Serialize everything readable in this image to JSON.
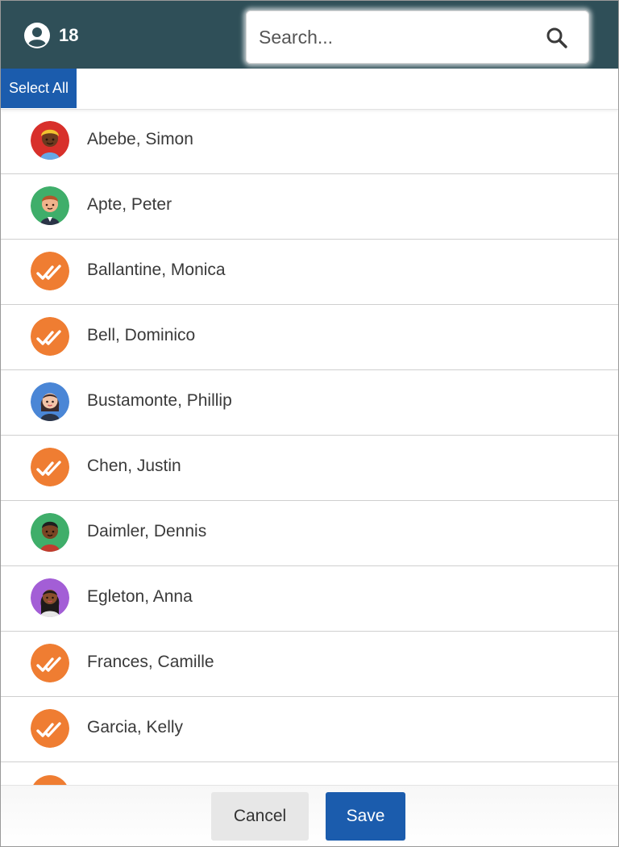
{
  "header": {
    "user_count": "18",
    "user_icon": "user-circle-icon",
    "search_placeholder": "Search...",
    "search_icon": "search-icon",
    "background_color": "#2f4f58"
  },
  "toolbar": {
    "select_all_label": "Select All",
    "accent_color": "#1b5cad"
  },
  "list": {
    "items": [
      {
        "name": "Abebe, Simon",
        "avatar": "avatar-person-red"
      },
      {
        "name": "Apte, Peter",
        "avatar": "avatar-person-green"
      },
      {
        "name": "Ballantine, Monica",
        "avatar": "double-check-icon"
      },
      {
        "name": "Bell, Dominico",
        "avatar": "double-check-icon"
      },
      {
        "name": "Bustamonte, Phillip",
        "avatar": "avatar-person-blue"
      },
      {
        "name": "Chen, Justin",
        "avatar": "double-check-icon"
      },
      {
        "name": "Daimler, Dennis",
        "avatar": "avatar-person-green"
      },
      {
        "name": "Egleton, Anna",
        "avatar": "avatar-person-purple"
      },
      {
        "name": "Frances, Camille",
        "avatar": "double-check-icon"
      },
      {
        "name": "Garcia, Kelly",
        "avatar": "double-check-icon"
      }
    ]
  },
  "footer": {
    "cancel_label": "Cancel",
    "save_label": "Save"
  }
}
